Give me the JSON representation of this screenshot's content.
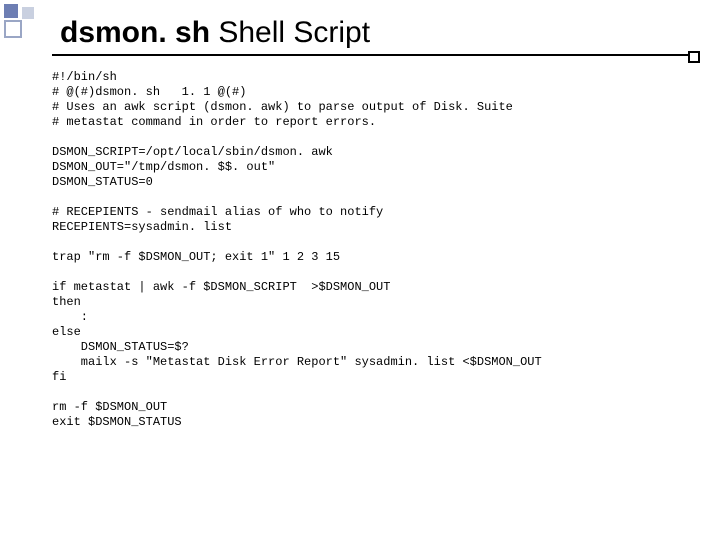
{
  "title": {
    "bold": "dsmon. sh",
    "normal": " Shell Script"
  },
  "code": "#!/bin/sh\n# @(#)dsmon. sh   1. 1 @(#)\n# Uses an awk script (dsmon. awk) to parse output of Disk. Suite\n# metastat command in order to report errors.\n\nDSMON_SCRIPT=/opt/local/sbin/dsmon. awk\nDSMON_OUT=\"/tmp/dsmon. $$. out\"\nDSMON_STATUS=0\n\n# RECEPIENTS - sendmail alias of who to notify\nRECEPIENTS=sysadmin. list\n\ntrap \"rm -f $DSMON_OUT; exit 1\" 1 2 3 15\n\nif metastat | awk -f $DSMON_SCRIPT  >$DSMON_OUT\nthen\n    :\nelse\n    DSMON_STATUS=$?\n    mailx -s \"Metastat Disk Error Report\" sysadmin. list <$DSMON_OUT\nfi\n\nrm -f $DSMON_OUT\nexit $DSMON_STATUS"
}
